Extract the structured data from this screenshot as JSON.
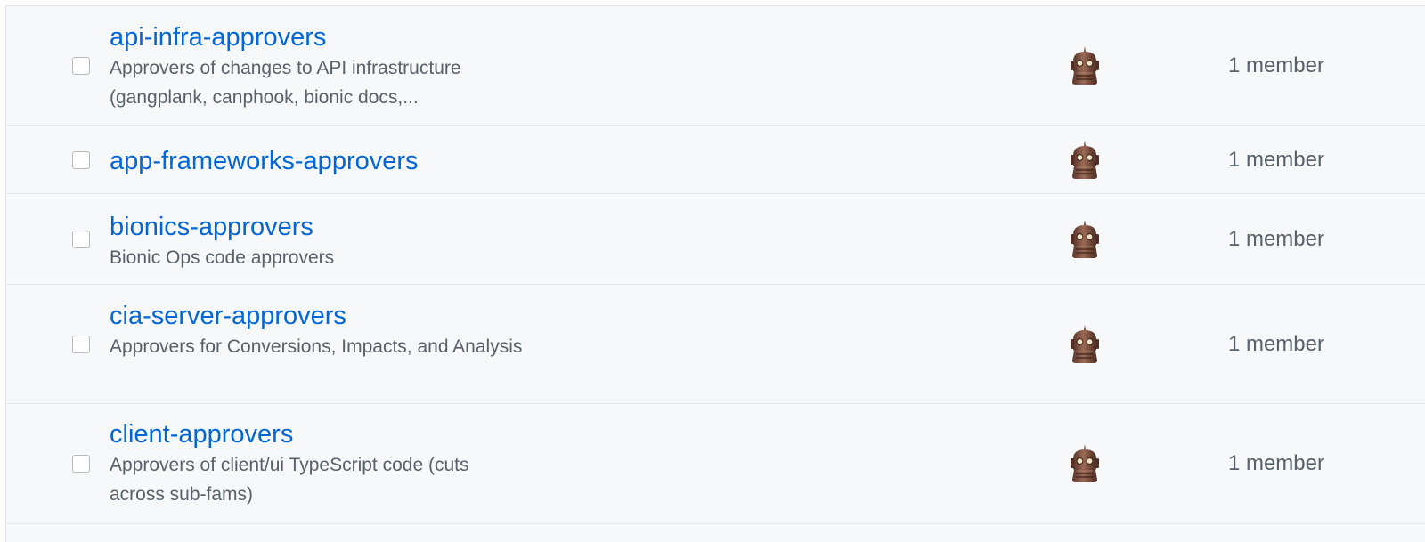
{
  "teams": [
    {
      "name": "api-infra-approvers",
      "description": "Approvers of changes to API infrastructure (gangplank, canphook, bionic docs,...",
      "members": "1 member",
      "avatar_icon": "robot-avatar-icon"
    },
    {
      "name": "app-frameworks-approvers",
      "description": "",
      "members": "1 member",
      "avatar_icon": "robot-avatar-icon"
    },
    {
      "name": "bionics-approvers",
      "description": "Bionic Ops code approvers",
      "members": "1 member",
      "avatar_icon": "robot-avatar-icon"
    },
    {
      "name": "cia-server-approvers",
      "description": "Approvers for Conversions, Impacts, and Analysis",
      "members": "1 member",
      "avatar_icon": "robot-avatar-icon"
    },
    {
      "name": "client-approvers",
      "description": "Approvers of client/ui TypeScript code (cuts across sub-fams)",
      "members": "1 member",
      "avatar_icon": "robot-avatar-icon"
    }
  ],
  "colors": {
    "link": "#0366d6",
    "muted_text": "#586069",
    "row_background": "#f6f8fa",
    "border": "#e1e4e8",
    "avatar_body": "#7a4f3f"
  }
}
